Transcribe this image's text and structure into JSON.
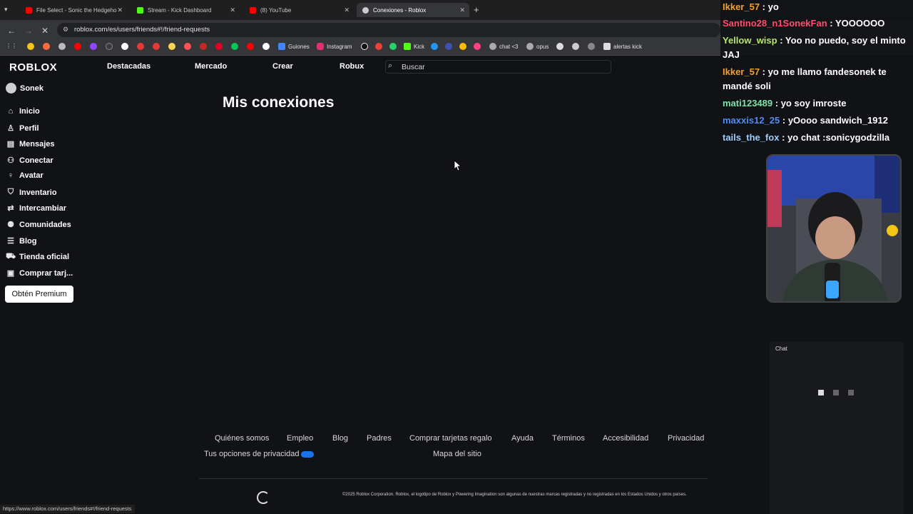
{
  "browser": {
    "tabs": [
      {
        "title": "File Select - Sonic the Hedgeho",
        "favicon_color": "#ff0000"
      },
      {
        "title": "Stream - Kick Dashboard",
        "favicon_color": "#53fc18"
      },
      {
        "title": "(8) YouTube",
        "favicon_color": "#ff0000"
      },
      {
        "title": "Conexiones - Roblox",
        "favicon_color": "#cccccc"
      }
    ],
    "url": "roblox.com/es/users/friends#!/friend-requests",
    "bookmarks": [
      {
        "label": "Guiones",
        "color": "#4285f4"
      },
      {
        "label": "Instagram",
        "color": "#e1306c"
      },
      {
        "label": "Kick",
        "color": "#53fc18"
      },
      {
        "label": "chat <3",
        "color": "#aaaaaa"
      },
      {
        "label": "opus",
        "color": "#aaaaaa"
      },
      {
        "label": "alertas kick",
        "color": "#dddddd"
      }
    ],
    "status_url": "https://www.roblox.com/users/friends#!/friend-requests"
  },
  "roblox": {
    "logo": "ROBLOX",
    "nav": [
      "Destacadas",
      "Mercado",
      "Crear",
      "Robux"
    ],
    "search_placeholder": "Buscar",
    "username": "Sonek",
    "sidebar": [
      {
        "label": "Inicio",
        "icon": "home-icon"
      },
      {
        "label": "Perfil",
        "icon": "profile-icon"
      },
      {
        "label": "Mensajes",
        "icon": "messages-icon"
      },
      {
        "label": "Conectar",
        "icon": "connect-icon"
      },
      {
        "label": "Avatar",
        "icon": "avatar-icon"
      },
      {
        "label": "Inventario",
        "icon": "inventory-icon"
      },
      {
        "label": "Intercambiar",
        "icon": "trade-icon"
      },
      {
        "label": "Comunidades",
        "icon": "communities-icon"
      },
      {
        "label": "Blog",
        "icon": "blog-icon"
      },
      {
        "label": "Tienda oficial",
        "icon": "store-icon"
      },
      {
        "label": "Comprar tarj...",
        "icon": "gift-card-icon"
      }
    ],
    "premium_button": "Obtén Premium",
    "page_title": "Mis conexiones",
    "footer_links": [
      "Quiénes somos",
      "Empleo",
      "Blog",
      "Padres",
      "Comprar tarjetas regalo",
      "Ayuda",
      "Términos",
      "Accesibilidad",
      "Privacidad"
    ],
    "privacy_options": "Tus opciones de privacidad",
    "sitemap": "Mapa del sitio",
    "legal": "©2025 Roblox Corporation. Roblox, el logotipo de Roblox y Powering Imagination son algunas de nuestras marcas registradas y no registradas en los Estados Unidos y otros países."
  },
  "stream": {
    "chat_messages": [
      {
        "user": "Ikker_57",
        "color": "#f0a030",
        "text": "yo"
      },
      {
        "user": "Santino28_n1SonekFan",
        "color": "#ff4d6d",
        "text": "YOOOOOO"
      },
      {
        "user": "Yellow_wisp",
        "color": "#b5e86a",
        "text": "Yoo no puedo, soy el minto JAJ"
      },
      {
        "user": "Ikker_57",
        "color": "#f0a030",
        "text": "yo me llamo fandesonek te mandé soli"
      },
      {
        "user": "mati123489",
        "color": "#7de3a8",
        "text": "yo soy imroste"
      },
      {
        "user": "maxxis12_25",
        "color": "#4f8df5",
        "text": "yOooo sandwich_1912"
      },
      {
        "user": "tails_the_fox",
        "color": "#9ad0ff",
        "text": "yo chat :sonicygodzilla"
      }
    ],
    "chat_panel_title": "Chat"
  }
}
